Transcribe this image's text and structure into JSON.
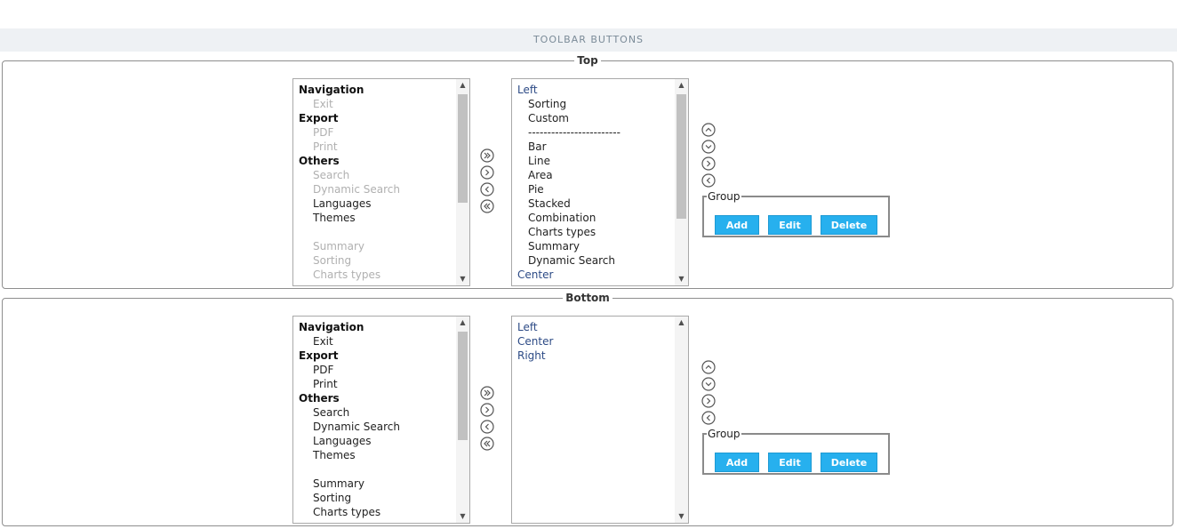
{
  "page": {
    "title": "TOOLBAR BUTTONS"
  },
  "colors": {
    "title_bg": "#eef1f4",
    "title_text": "#7b8b98",
    "button_bg": "#27b0ee",
    "zone_text": "#2c4a85",
    "disabled_text": "#b0b0b0"
  },
  "icons": {
    "move_all_right": "double-chevron-right-icon",
    "move_right": "chevron-right-icon",
    "move_left": "chevron-left-icon",
    "move_all_left": "double-chevron-left-icon",
    "move_up": "chevron-up-icon",
    "move_down": "chevron-down-icon"
  },
  "sections": {
    "top": {
      "legend": "Top",
      "available": [
        {
          "label": "Navigation",
          "kind": "group"
        },
        {
          "label": "Exit",
          "kind": "child",
          "disabled": true
        },
        {
          "label": "Export",
          "kind": "group"
        },
        {
          "label": "PDF",
          "kind": "child",
          "disabled": true
        },
        {
          "label": "Print",
          "kind": "child",
          "disabled": true
        },
        {
          "label": "Others",
          "kind": "group"
        },
        {
          "label": "Search",
          "kind": "child",
          "disabled": true
        },
        {
          "label": "Dynamic Search",
          "kind": "child",
          "disabled": true
        },
        {
          "label": "Languages",
          "kind": "child",
          "disabled": false
        },
        {
          "label": "Themes",
          "kind": "child",
          "disabled": false
        },
        {
          "label": "",
          "kind": "blank"
        },
        {
          "label": "Summary",
          "kind": "child",
          "disabled": true
        },
        {
          "label": "Sorting",
          "kind": "child",
          "disabled": true
        },
        {
          "label": "Charts types",
          "kind": "child",
          "disabled": true
        }
      ],
      "selected": [
        {
          "label": "Left",
          "kind": "zone"
        },
        {
          "label": "Sorting",
          "kind": "sub"
        },
        {
          "label": "Custom",
          "kind": "sub"
        },
        {
          "label": "------------------------",
          "kind": "sub"
        },
        {
          "label": "Bar",
          "kind": "sub"
        },
        {
          "label": "Line",
          "kind": "sub"
        },
        {
          "label": "Area",
          "kind": "sub"
        },
        {
          "label": "Pie",
          "kind": "sub"
        },
        {
          "label": "Stacked",
          "kind": "sub"
        },
        {
          "label": "Combination",
          "kind": "sub"
        },
        {
          "label": "Charts types",
          "kind": "sub"
        },
        {
          "label": "Summary",
          "kind": "sub"
        },
        {
          "label": "Dynamic Search",
          "kind": "sub"
        },
        {
          "label": "Center",
          "kind": "zone"
        }
      ],
      "group": {
        "legend": "Group",
        "add": "Add",
        "edit": "Edit",
        "delete": "Delete"
      }
    },
    "bottom": {
      "legend": "Bottom",
      "available": [
        {
          "label": "Navigation",
          "kind": "group"
        },
        {
          "label": "Exit",
          "kind": "child",
          "disabled": false
        },
        {
          "label": "Export",
          "kind": "group"
        },
        {
          "label": "PDF",
          "kind": "child",
          "disabled": false
        },
        {
          "label": "Print",
          "kind": "child",
          "disabled": false
        },
        {
          "label": "Others",
          "kind": "group"
        },
        {
          "label": "Search",
          "kind": "child",
          "disabled": false
        },
        {
          "label": "Dynamic Search",
          "kind": "child",
          "disabled": false
        },
        {
          "label": "Languages",
          "kind": "child",
          "disabled": false
        },
        {
          "label": "Themes",
          "kind": "child",
          "disabled": false
        },
        {
          "label": "",
          "kind": "blank"
        },
        {
          "label": "Summary",
          "kind": "child",
          "disabled": false
        },
        {
          "label": "Sorting",
          "kind": "child",
          "disabled": false
        },
        {
          "label": "Charts types",
          "kind": "child",
          "disabled": false
        }
      ],
      "selected": [
        {
          "label": "Left",
          "kind": "zone"
        },
        {
          "label": "Center",
          "kind": "zone"
        },
        {
          "label": "Right",
          "kind": "zone"
        }
      ],
      "group": {
        "legend": "Group",
        "add": "Add",
        "edit": "Edit",
        "delete": "Delete"
      }
    }
  }
}
